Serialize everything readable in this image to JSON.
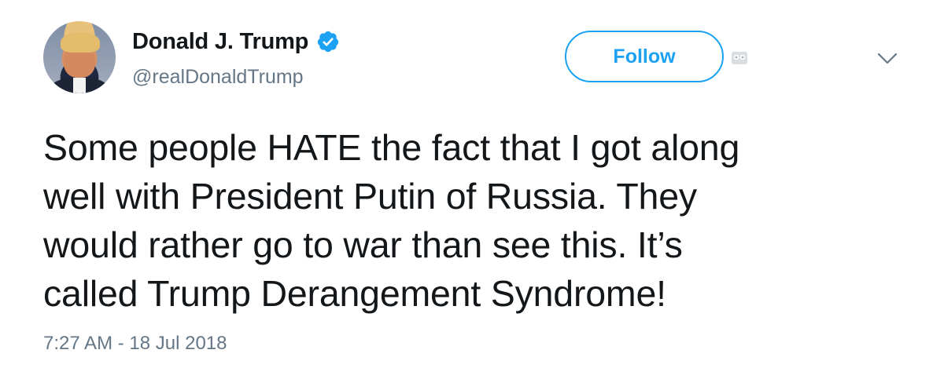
{
  "user": {
    "display_name": "Donald J. Trump",
    "handle": "@realDonaldTrump",
    "verified": true,
    "avatar": "profile-photo"
  },
  "actions": {
    "follow_label": "Follow",
    "more_menu_icon": "chevron-down-icon",
    "owl_icon": "owl-icon"
  },
  "tweet": {
    "lines": [
      "Some people HATE the fact that I got along",
      "well with President Putin of Russia. They",
      "would rather go to war than see this. It’s",
      "called Trump Derangement Syndrome!"
    ],
    "timestamp": "7:27 AM - 18 Jul 2018"
  },
  "colors": {
    "accent": "#1da1f2",
    "text_primary": "#14171a",
    "text_secondary": "#657786",
    "background": "#ffffff"
  }
}
